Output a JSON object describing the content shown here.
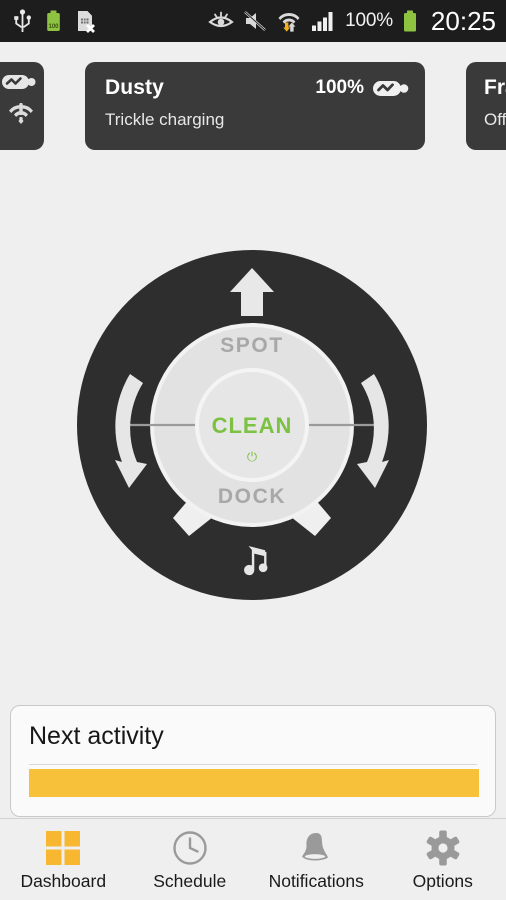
{
  "statusbar": {
    "icons_left": [
      "usb-icon",
      "battery-full-green-icon",
      "sim-card-error-icon"
    ],
    "icons_right": [
      "eye-smart-stay-icon",
      "volume-muted-icon",
      "wifi-data-transfer-icon",
      "cellular-signal-icon"
    ],
    "battery_percent": "100%",
    "clock": "20:25"
  },
  "cards": {
    "left_peek": {
      "name": "",
      "sub": "",
      "icons": [
        "battery-charging-icon",
        "wifi-alert-icon"
      ]
    },
    "main": {
      "name": "Dusty",
      "battery_percent": "100%",
      "battery_icon": "battery-charging-icon",
      "status": "Trickle charging"
    },
    "right_peek": {
      "name": "Fra",
      "sub": "Off"
    }
  },
  "dial": {
    "up_label": "up-arrow-icon",
    "left_label": "rotate-left-arrow-icon",
    "right_label": "rotate-right-arrow-icon",
    "music_label": "music-note-icon",
    "spot": "SPOT",
    "dock": "DOCK",
    "clean": "CLEAN",
    "power_glyph": "⏻",
    "colors": {
      "ring": "#2e2e2e",
      "disc": "#e2e2e2",
      "inner": "#e6e6e6",
      "accent_green": "#7cc142",
      "label_gray": "#a8a8a8"
    }
  },
  "activity": {
    "title": "Next activity",
    "bar_color": "#f7c139",
    "bar_percent": 100
  },
  "bottomnav": {
    "items": [
      {
        "label": "Dashboard",
        "icon": "grid-squares-icon",
        "active": true
      },
      {
        "label": "Schedule",
        "icon": "clock-icon",
        "active": false
      },
      {
        "label": "Notifications",
        "icon": "bell-icon",
        "active": false
      },
      {
        "label": "Options",
        "icon": "gear-icon",
        "active": false
      }
    ],
    "active_color": "#f7b731",
    "inactive_color": "#999999"
  }
}
